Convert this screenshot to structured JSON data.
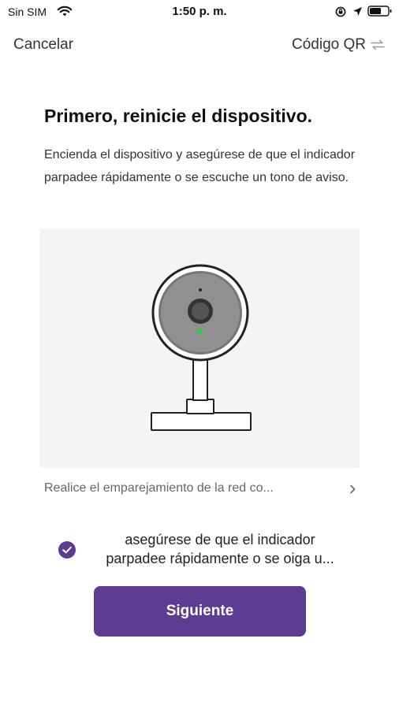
{
  "status_bar": {
    "carrier": "Sin SIM",
    "time": "1:50 p. m.",
    "icons": [
      "wifi-icon",
      "orientation-lock-icon",
      "location-arrow-icon",
      "battery-icon"
    ]
  },
  "nav": {
    "cancel_label": "Cancelar",
    "qr_label": "Código QR",
    "qr_icon": "swap-arrows-icon"
  },
  "main": {
    "title": "Primero, reinicie el dispositivo.",
    "description": "Encienda el dispositivo y asegúrese de que el indicador parpadee rápidamente o se escuche un tono de aviso.",
    "illustration_icon": "security-camera-icon",
    "pairing_link": "Realice el emparejamiento de la red co...",
    "confirm_line1": "asegúrese de que el indicador",
    "confirm_line2": "parpadee rápidamente o se oiga u...",
    "confirm_checked": true,
    "next_label": "Siguiente"
  },
  "colors": {
    "accent": "#5c3d91",
    "illustration_bg": "#f4f4f4",
    "indicator_led": "#2ecc40",
    "text_secondary": "#666666"
  }
}
